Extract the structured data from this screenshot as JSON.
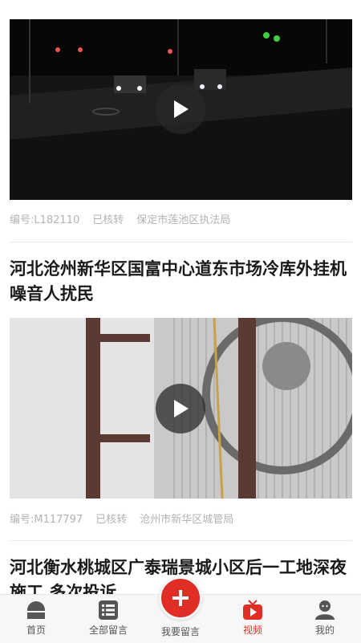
{
  "feed": {
    "items": [
      {
        "meta": {
          "id": "编号:L182110",
          "status": "已核转",
          "dept": "保定市莲池区执法局"
        }
      },
      {
        "title": "河北沧州新华区国富中心道东市场冷库外挂机噪音人扰民",
        "meta": {
          "id": "编号:M117797",
          "status": "已核转",
          "dept": "沧州市新华区城管局"
        }
      },
      {
        "title": "河北衡水桃城区广泰瑞景城小区后一工地深夜施工 多次投诉"
      }
    ]
  },
  "tabbar": {
    "home": "首页",
    "all_messages": "全部留言",
    "post_message": "我要留言",
    "video": "视频",
    "mine": "我的",
    "active_color": "#e02e24"
  }
}
